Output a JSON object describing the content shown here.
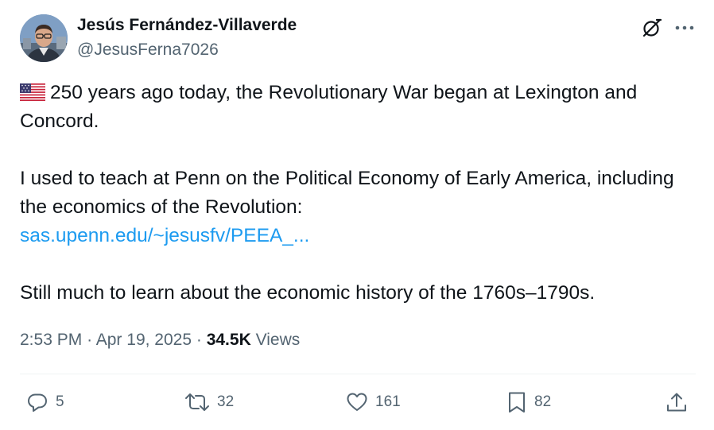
{
  "author": {
    "name": "Jesús Fernández-Villaverde",
    "handle": "@JesusFerna7026"
  },
  "header_icons": [
    "grok-icon",
    "more-icon"
  ],
  "tweet": {
    "line1": "250 years ago today, the Revolutionary War began at Lexington and Concord.",
    "line2": "I used to teach at Penn on the Political Economy of Early America, including the economics of the Revolution:",
    "link": "sas.upenn.edu/~jesusfv/PEEA_...",
    "line3": "Still much to learn about the economic history of the 1760s–1790s.",
    "flag_icon": "us-flag-icon"
  },
  "meta": {
    "time": "2:53 PM",
    "separator": "·",
    "date": "Apr 19, 2025",
    "views_count": "34.5K",
    "views_label": "Views"
  },
  "actions": {
    "replies": "5",
    "reposts": "32",
    "likes": "161",
    "bookmarks": "82"
  },
  "colors": {
    "text": "#0f1419",
    "secondary": "#536471",
    "link": "#1d9bf0",
    "divider": "#eff3f4"
  }
}
